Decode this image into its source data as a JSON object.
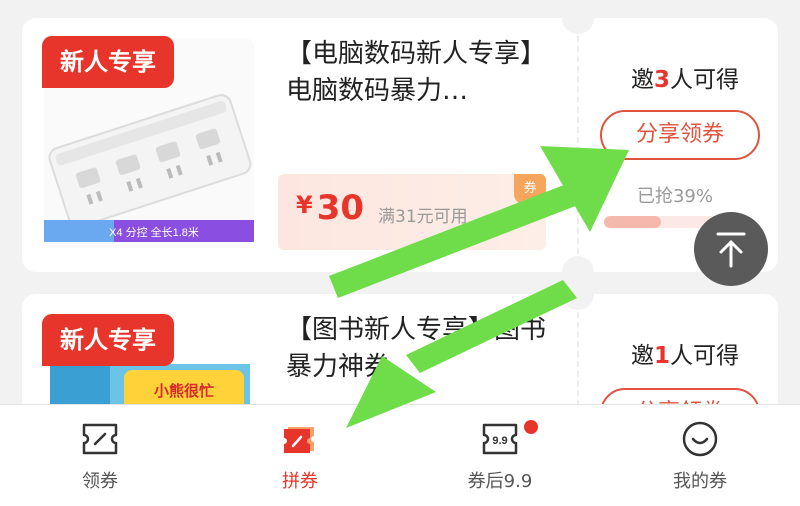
{
  "items": [
    {
      "badge": "新人专享",
      "title": "【电脑数码新人专享】电脑数码暴力…",
      "coupon": {
        "currency": "¥",
        "amount": "30",
        "condition": "满31元可用",
        "tag": "券"
      },
      "invite": {
        "prefix": "邀",
        "count": "3",
        "suffix": "人可得"
      },
      "share_label": "分享领券",
      "progress_text": "已抢39%",
      "progress": 0.39,
      "product_label": "X4 分控 全长1.8米"
    },
    {
      "badge": "新人专享",
      "title": "【图书新人专享】图书暴力神券",
      "invite": {
        "prefix": "邀",
        "count": "1",
        "suffix": "人可得"
      },
      "share_label": "分享领券",
      "product_label": "小熊很忙"
    }
  ],
  "tabs": [
    {
      "label": "领券",
      "icon": "coupon-ticket-icon"
    },
    {
      "label": "拼券",
      "icon": "group-coupon-icon",
      "active": true
    },
    {
      "label": "券后9.9",
      "icon": "after-coupon-9.9-icon",
      "icon_text": "9.9"
    },
    {
      "label": "我的券",
      "icon": "smile-icon"
    }
  ],
  "colors": {
    "accent": "#e8352b",
    "arrow": "#6fdd4a"
  }
}
